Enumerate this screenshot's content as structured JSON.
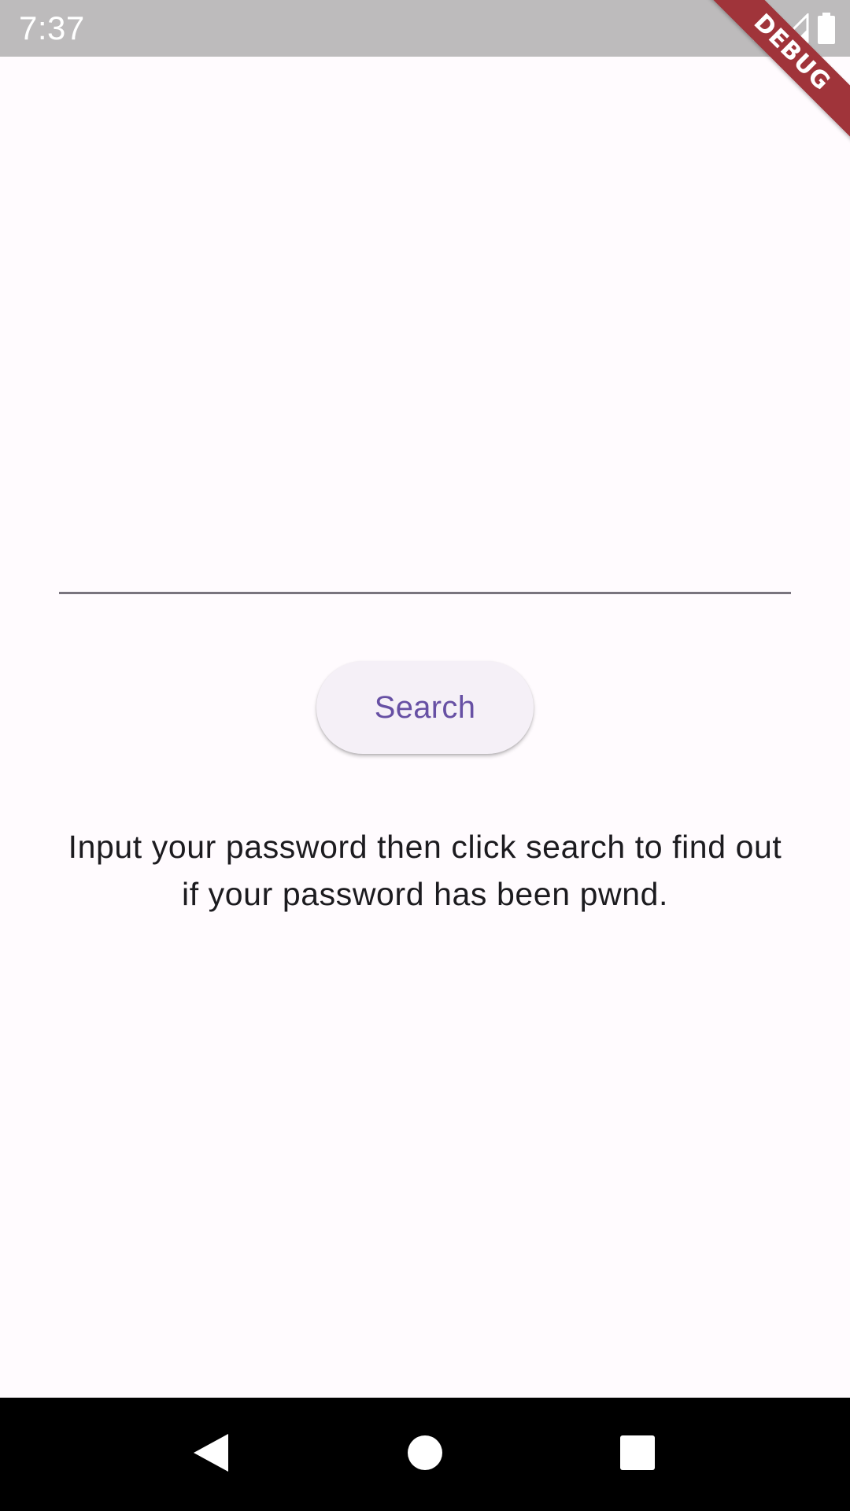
{
  "status_bar": {
    "time": "7:37",
    "icons": [
      "wifi-icon",
      "signal-icon",
      "battery-icon"
    ]
  },
  "debug_banner": {
    "label": "DEBUG",
    "color": "#a0343a"
  },
  "password_field": {
    "value": "",
    "placeholder": ""
  },
  "search_button": {
    "label": "Search"
  },
  "info": {
    "text": "Input your password then click search to find out if your password has been pwnd."
  },
  "nav_bar": {
    "buttons": [
      "back-icon",
      "home-icon",
      "recents-icon"
    ]
  },
  "colors": {
    "background": "#fffbfe",
    "accent": "#6750a4",
    "status_bar": "#bdbbbc",
    "text": "#1c1b1f"
  }
}
